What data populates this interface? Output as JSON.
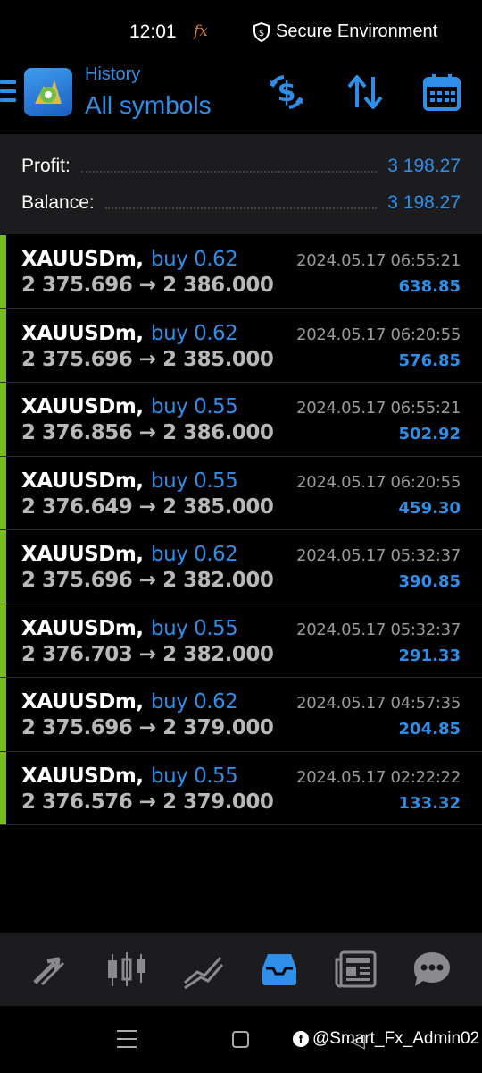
{
  "status_bar": {
    "time": "12:01",
    "fx_badge": "fx",
    "secure_label": "Secure Environment"
  },
  "header": {
    "subtitle": "History",
    "title": "All symbols",
    "icons": [
      "menu-icon",
      "metatrader-app-icon",
      "currency-exchange-icon",
      "sort-icon",
      "calendar-icon"
    ]
  },
  "summary": {
    "profit_label": "Profit:",
    "profit_value": "3 198.27",
    "balance_label": "Balance:",
    "balance_value": "3 198.27"
  },
  "trades": [
    {
      "symbol": "XAUUSDm,",
      "side": "buy 0.62",
      "open": "2 375.696",
      "close": "2 386.000",
      "time": "2024.05.17 06:55:21",
      "profit": "638.85"
    },
    {
      "symbol": "XAUUSDm,",
      "side": "buy 0.62",
      "open": "2 375.696",
      "close": "2 385.000",
      "time": "2024.05.17 06:20:55",
      "profit": "576.85"
    },
    {
      "symbol": "XAUUSDm,",
      "side": "buy 0.55",
      "open": "2 376.856",
      "close": "2 386.000",
      "time": "2024.05.17 06:55:21",
      "profit": "502.92"
    },
    {
      "symbol": "XAUUSDm,",
      "side": "buy 0.55",
      "open": "2 376.649",
      "close": "2 385.000",
      "time": "2024.05.17 06:20:55",
      "profit": "459.30"
    },
    {
      "symbol": "XAUUSDm,",
      "side": "buy 0.62",
      "open": "2 375.696",
      "close": "2 382.000",
      "time": "2024.05.17 05:32:37",
      "profit": "390.85"
    },
    {
      "symbol": "XAUUSDm,",
      "side": "buy 0.55",
      "open": "2 376.703",
      "close": "2 382.000",
      "time": "2024.05.17 05:32:37",
      "profit": "291.33"
    },
    {
      "symbol": "XAUUSDm,",
      "side": "buy 0.62",
      "open": "2 375.696",
      "close": "2 379.000",
      "time": "2024.05.17 04:57:35",
      "profit": "204.85"
    },
    {
      "symbol": "XAUUSDm,",
      "side": "buy 0.55",
      "open": "2 376.576",
      "close": "2 379.000",
      "time": "2024.05.17 02:22:22",
      "profit": "133.32"
    }
  ],
  "arrow": "→",
  "bottom_nav": [
    "quotes-icon",
    "chart-icon",
    "trade-icon",
    "history-icon",
    "news-icon",
    "chat-icon"
  ],
  "watermark": "@Smart_Fx_Admin02",
  "colors": {
    "accent": "#2f8fe8",
    "buy_bar": "#7cbd1e",
    "fx_badge": "#e07a2e"
  }
}
